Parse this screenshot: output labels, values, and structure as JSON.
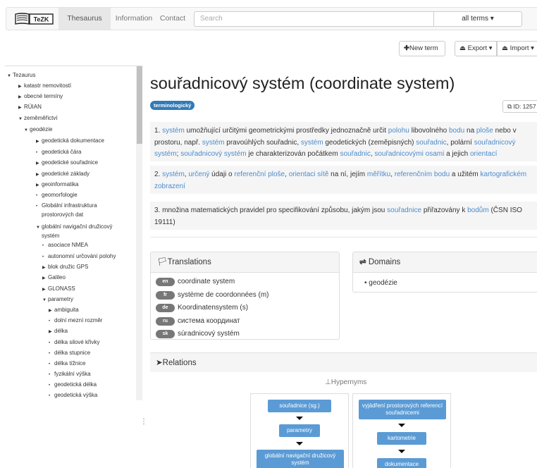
{
  "navbar": {
    "logo_text": "TeZK",
    "nav": [
      {
        "label": "Thesaurus"
      },
      {
        "label": "Information"
      },
      {
        "label": "Contact"
      }
    ],
    "search_placeholder": "Search",
    "terms_dropdown": "all terms ▾"
  },
  "toolbar": {
    "new_term": "New term",
    "export": "Export ▾",
    "import": "Import ▾"
  },
  "tree": [
    {
      "label": "Tezaurus",
      "level": 0,
      "caret": "down"
    },
    {
      "label": "katastr nemovitostí",
      "level": 1,
      "caret": "right"
    },
    {
      "label": "obecné termíny",
      "level": 1,
      "caret": "right"
    },
    {
      "label": "RÚIAN",
      "level": 1,
      "caret": "right"
    },
    {
      "label": "zeměměřictví",
      "level": 1,
      "caret": "down"
    },
    {
      "label": "geodézie",
      "level": 2,
      "caret": "down"
    },
    {
      "label": "geodetická dokumentace",
      "level": 3,
      "caret": "right"
    },
    {
      "label": "geodetická čára",
      "level": 3,
      "caret": "leaf"
    },
    {
      "label": "geodetické souřadnice",
      "level": 3,
      "caret": "right"
    },
    {
      "label": "geodetické základy",
      "level": 3,
      "caret": "right"
    },
    {
      "label": "geoinformatika",
      "level": 3,
      "caret": "right"
    },
    {
      "label": "geomorfologie",
      "level": 3,
      "caret": "leaf"
    },
    {
      "label": "Globální infrastruktura",
      "label2": "prostorových dat",
      "level": 3,
      "caret": "leaf"
    },
    {
      "label": "globální navigační družicový",
      "label2": "systém",
      "level": 3,
      "caret": "down"
    },
    {
      "label": "asociace NMEA",
      "level": 4,
      "caret": "leaf"
    },
    {
      "label": "autonomní určování polohy",
      "level": 4,
      "caret": "leaf"
    },
    {
      "label": "blok družic GPS",
      "level": 4,
      "caret": "right"
    },
    {
      "label": "Galileo",
      "level": 4,
      "caret": "right"
    },
    {
      "label": "GLONASS",
      "level": 4,
      "caret": "right"
    },
    {
      "label": "parametry",
      "level": 4,
      "caret": "down"
    },
    {
      "label": "ambiguita",
      "level": 5,
      "caret": "right"
    },
    {
      "label": "dolní mezní rozměr",
      "level": 5,
      "caret": "leaf"
    },
    {
      "label": "délka",
      "level": 5,
      "caret": "right"
    },
    {
      "label": "délka silové křivky",
      "level": 5,
      "caret": "leaf"
    },
    {
      "label": "délka stupnice",
      "level": 5,
      "caret": "leaf"
    },
    {
      "label": "délka tížnice",
      "level": 5,
      "caret": "leaf"
    },
    {
      "label": "fyzikální výška",
      "level": 5,
      "caret": "leaf"
    },
    {
      "label": "geodetická délka",
      "level": 5,
      "caret": "leaf"
    },
    {
      "label": "geodetická výška",
      "level": 5,
      "caret": "leaf"
    }
  ],
  "term": {
    "title": "souřadnicový systém (coordinate system)",
    "badge": "terminologický",
    "id_label": "ID: 1257"
  },
  "definitions": [
    [
      [
        "1. "
      ],
      [
        "systém",
        true
      ],
      [
        " umožňující určitými geometrickými prostředky jednoznačně určit "
      ],
      [
        "polohu",
        true
      ],
      [
        " libovolného "
      ],
      [
        "bodu",
        true
      ],
      [
        " na "
      ],
      [
        "ploše",
        true
      ],
      [
        " nebo v prostoru, např. "
      ],
      [
        "systém",
        true
      ],
      [
        " pravoúhlých souřadnic, "
      ],
      [
        "systém",
        true
      ],
      [
        " geodetických (zeměpisných) "
      ],
      [
        "souřadnic",
        true
      ],
      [
        ", polární "
      ],
      [
        "souřadnicový systém",
        true
      ],
      [
        "; "
      ],
      [
        "souřadnicový systém",
        true
      ],
      [
        " je charakterizován počátkem "
      ],
      [
        "souřadnic",
        true
      ],
      [
        ", "
      ],
      [
        "souřadnicovými osami",
        true
      ],
      [
        " a jejich "
      ],
      [
        "orientací",
        true
      ]
    ],
    [
      [
        "2. "
      ],
      [
        "systém",
        true
      ],
      [
        ", "
      ],
      [
        "určený",
        true
      ],
      [
        " údaji o "
      ],
      [
        "referenční ploše",
        true
      ],
      [
        ", "
      ],
      [
        "orientaci sítě",
        true
      ],
      [
        " na ní, jejím "
      ],
      [
        "měřítku",
        true
      ],
      [
        ", "
      ],
      [
        "referenčním bodu",
        true
      ],
      [
        " a užitém "
      ],
      [
        "kartografickém zobrazení",
        true
      ]
    ],
    [
      [
        "3. množina matematických pravidel pro specifikování způsobu, jakým jsou "
      ],
      [
        "souřadnice",
        true
      ],
      [
        " přiřazovány k "
      ],
      [
        "bodům",
        true
      ],
      [
        " (ČSN ISO 19111)"
      ]
    ]
  ],
  "translations": {
    "heading": "Translations",
    "items": [
      {
        "lang": "en",
        "text": "coordinate system"
      },
      {
        "lang": "fr",
        "text": "système de coordonnées (m)"
      },
      {
        "lang": "de",
        "text": "Koordinatensystem (s)"
      },
      {
        "lang": "ru",
        "text": "система координат"
      },
      {
        "lang": "sk",
        "text": "súradnicový systém"
      }
    ]
  },
  "domains": {
    "heading": "Domains",
    "items": [
      "geodézie"
    ]
  },
  "relations": {
    "heading": "Relations",
    "hypernyms_label": "Hypernyms",
    "chain_left": [
      "souřadnice (sg.)",
      "parametry",
      "globální navigační družicový systém"
    ],
    "chain_right": [
      "vyjádření prostorových referencí souřadnicemi",
      "kartometrie",
      "dokumentace"
    ]
  },
  "colors": {
    "link": "#4a8ccf",
    "node": "#5b9bd5",
    "badge": "#337ab7",
    "lang_badge": "#777777"
  }
}
